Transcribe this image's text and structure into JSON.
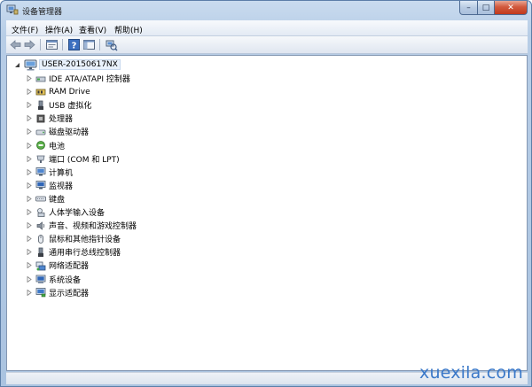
{
  "window": {
    "title": "设备管理器",
    "controls": {
      "minimize": "–",
      "maximize": "□",
      "close": "✕"
    }
  },
  "menu": [
    {
      "label": "文件(F)"
    },
    {
      "label": "操作(A)"
    },
    {
      "label": "查看(V)"
    },
    {
      "label": "帮助(H)"
    }
  ],
  "toolbar": {
    "icons": [
      "back-arrow-icon",
      "forward-arrow-icon",
      "properties-icon",
      "help-icon",
      "console-tree-icon",
      "scan-hardware-icon"
    ]
  },
  "tree": {
    "root": "USER-20150617NX",
    "items": [
      {
        "label": "IDE ATA/ATAPI 控制器",
        "icon": "ide-controller-icon"
      },
      {
        "label": "RAM Drive",
        "icon": "ram-drive-icon"
      },
      {
        "label": "USB 虚拟化",
        "icon": "usb-icon"
      },
      {
        "label": "处理器",
        "icon": "processor-icon"
      },
      {
        "label": "磁盘驱动器",
        "icon": "disk-drive-icon"
      },
      {
        "label": "电池",
        "icon": "battery-icon"
      },
      {
        "label": "端口 (COM 和 LPT)",
        "icon": "port-icon"
      },
      {
        "label": "计算机",
        "icon": "computer-icon"
      },
      {
        "label": "监视器",
        "icon": "monitor-icon"
      },
      {
        "label": "键盘",
        "icon": "keyboard-icon"
      },
      {
        "label": "人体学输入设备",
        "icon": "hid-icon"
      },
      {
        "label": "声音、视频和游戏控制器",
        "icon": "sound-icon"
      },
      {
        "label": "鼠标和其他指针设备",
        "icon": "mouse-icon"
      },
      {
        "label": "通用串行总线控制器",
        "icon": "usb-controller-icon"
      },
      {
        "label": "网络适配器",
        "icon": "network-adapter-icon"
      },
      {
        "label": "系统设备",
        "icon": "system-device-icon"
      },
      {
        "label": "显示适配器",
        "icon": "display-adapter-icon"
      }
    ]
  },
  "watermark": "xuexila.com",
  "colors": {
    "accent": "#3a78c8",
    "selection_bg": "#e9f1fb"
  }
}
